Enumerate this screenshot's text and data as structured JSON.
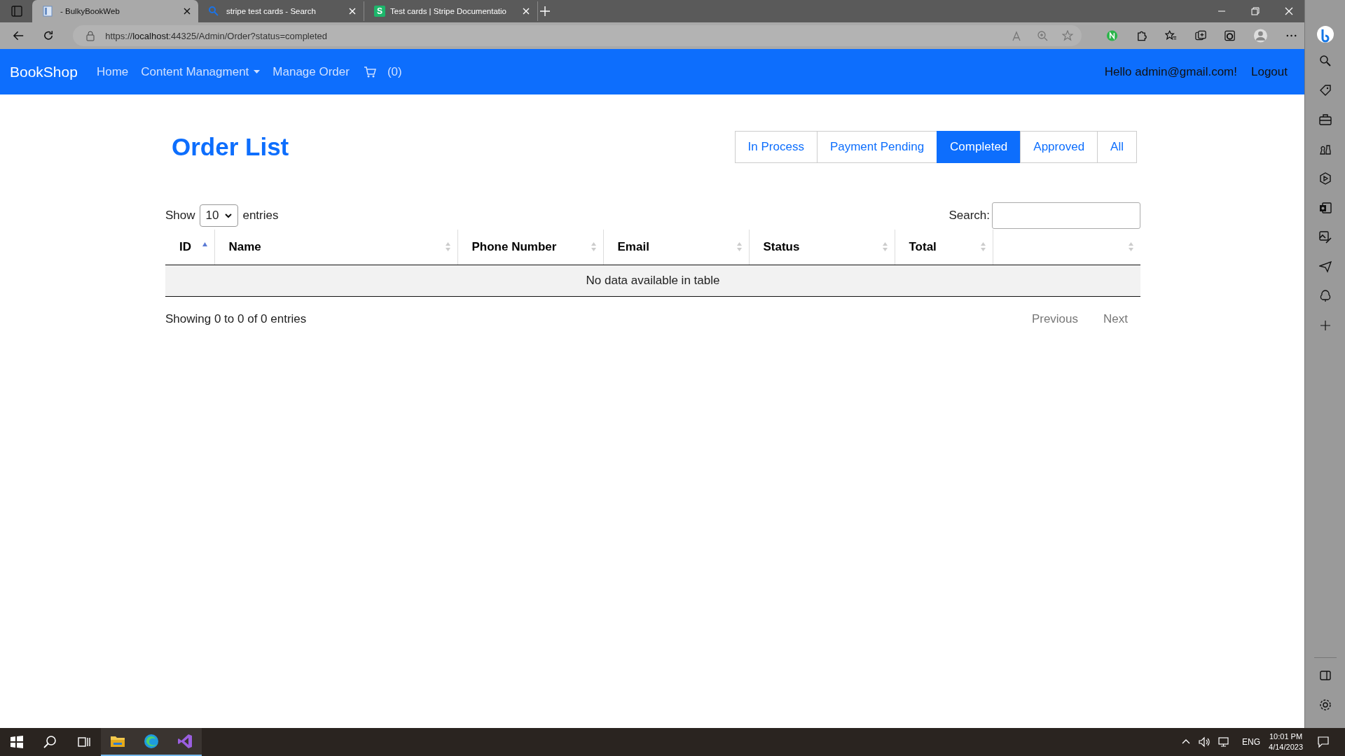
{
  "browser": {
    "tabs": [
      {
        "title": "- BulkyBookWeb",
        "selected": true
      },
      {
        "title": "stripe test cards - Search",
        "selected": false
      },
      {
        "title": "Test cards | Stripe Documentatio",
        "icon_text": "S",
        "selected": false
      }
    ],
    "address": {
      "prefix": "https://",
      "host": "localhost",
      "rest": ":44325/Admin/Order?status=completed"
    }
  },
  "navbar": {
    "brand": "BookShop",
    "links": [
      {
        "label": "Home",
        "kind": "link"
      },
      {
        "label": "Content Managment",
        "kind": "dropdown"
      },
      {
        "label": "Manage Order",
        "kind": "link"
      },
      {
        "label": "(0)",
        "kind": "cart"
      }
    ],
    "greeting": "Hello admin@gmail.com!",
    "logout": "Logout"
  },
  "page": {
    "title": "Order List",
    "filters": [
      {
        "label": "In Process",
        "selected": false
      },
      {
        "label": "Payment Pending",
        "selected": false
      },
      {
        "label": "Completed",
        "selected": true
      },
      {
        "label": "Approved",
        "selected": false
      },
      {
        "label": "All",
        "selected": false
      }
    ],
    "length": {
      "before": "Show",
      "value": "10",
      "after": "entries"
    },
    "search_label": "Search:",
    "table": {
      "columns": [
        {
          "label": "ID",
          "sorted": true
        },
        {
          "label": "Name",
          "sorted": false
        },
        {
          "label": "Phone Number",
          "sorted": false
        },
        {
          "label": "Email",
          "sorted": false
        },
        {
          "label": "Status",
          "sorted": false
        },
        {
          "label": "Total",
          "sorted": false
        },
        {
          "sorted": false
        }
      ],
      "empty": "No data available in table"
    },
    "info": "Showing 0 to 0 of 0 entries",
    "pager": [
      {
        "label": "Previous",
        "disabled": true
      },
      {
        "label": "Next",
        "disabled": true
      }
    ]
  },
  "taskbar": {
    "time": "10:01 PM",
    "date": "4/14/2023",
    "lang": "ENG"
  }
}
